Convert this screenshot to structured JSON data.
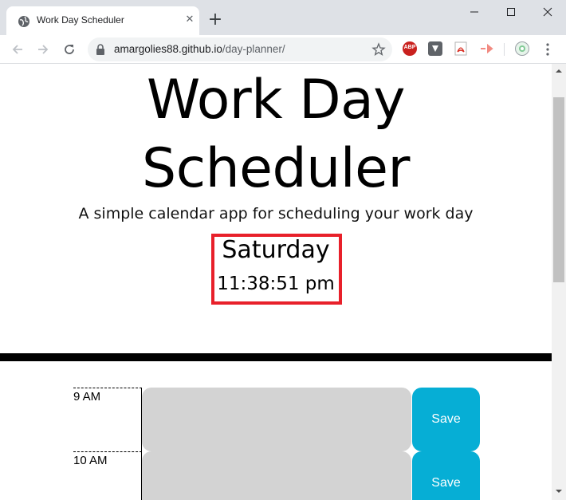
{
  "browser": {
    "tab_title": "Work Day Scheduler",
    "url_host": "amargolies88.github.io",
    "url_path": "/day-planner/",
    "extensions": [
      "adblock-plus-icon",
      "shield-extension-icon",
      "pdf-extension-icon",
      "cast-extension-icon",
      "profile-avatar-icon"
    ],
    "abp_label": "ABP"
  },
  "header": {
    "title_line1": "Work Day",
    "title_line2": "Scheduler",
    "subtitle": "A simple calendar app for scheduling your work day",
    "day": "Saturday",
    "time": "11:38:51 pm"
  },
  "rows": [
    {
      "hour": "9 AM",
      "save_label": "Save"
    },
    {
      "hour": "10 AM",
      "save_label": "Save"
    }
  ],
  "colors": {
    "save_button": "#06aed5",
    "textarea": "#d3d3d3",
    "highlight_border": "#e8202a",
    "divider": "#000000"
  }
}
